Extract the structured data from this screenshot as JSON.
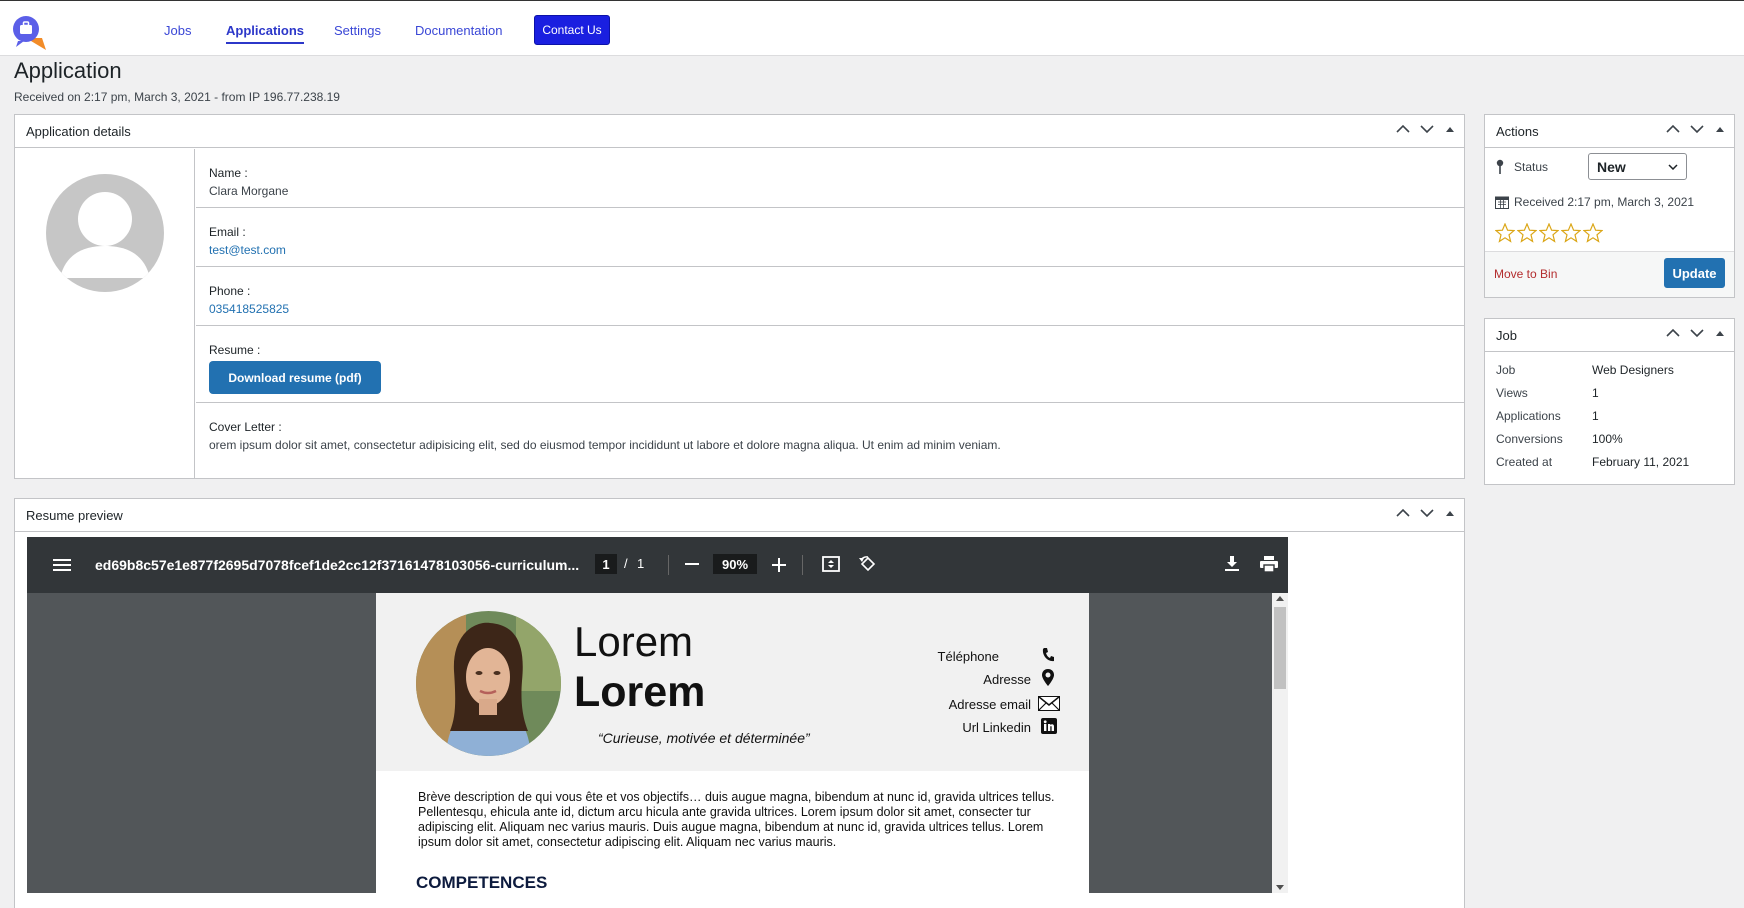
{
  "nav": {
    "items": [
      "Jobs",
      "Applications",
      "Settings",
      "Documentation"
    ],
    "contact_label": "Contact Us"
  },
  "page": {
    "title": "Application",
    "subtitle": "Received on 2:17 pm, March 3, 2021 - from IP 196.77.238.19"
  },
  "details": {
    "title": "Application details",
    "name_label": "Name :",
    "name_value": "Clara Morgane",
    "email_label": "Email :",
    "email_value": "test@test.com",
    "phone_label": "Phone :",
    "phone_value": "035418525825",
    "resume_label": "Resume :",
    "download_label": "Download resume (pdf)",
    "cover_label": "Cover Letter :",
    "cover_value": "orem ipsum dolor sit amet, consectetur adipisicing elit, sed do eiusmod tempor incididunt ut labore et dolore magna aliqua. Ut enim ad minim veniam."
  },
  "preview": {
    "title": "Resume preview",
    "filename": "ed69b8c57e1e877f2695d7078fcef1de2cc12f37161478103056-curriculum...",
    "page_current": "1",
    "page_sep": "/",
    "page_total": "1",
    "zoom": "90%",
    "cv": {
      "first_name": "Lorem",
      "last_name": "Lorem",
      "tagline": "“Curieuse, motivée et déterminée”",
      "contacts": [
        "Téléphone",
        "Adresse",
        "Adresse email",
        "Url Linkedin"
      ],
      "description": "Brève description de qui vous ête et vos objectifs… duis augue magna, bibendum at nunc id, gravida ultrices tellus. Pellentesqu, ehicula ante id, dictum arcu hicula ante gravida ultrices. Lorem ipsum dolor sit amet, consecter tur adipiscing elit. Aliquam nec varius mauris. Duis augue magna, bibendum at nunc id, gravida ultrices tellus. Lorem ipsum dolor sit amet, consectetur adipiscing elit. Aliquam nec varius mauris.",
      "section": "COMPETENCES"
    }
  },
  "actions": {
    "title": "Actions",
    "status_label": "Status",
    "status_value": "New",
    "received": "Received 2:17 pm, March 3, 2021",
    "rating": 0,
    "rating_max": 5,
    "bin_label": "Move to Bin",
    "update_label": "Update"
  },
  "job": {
    "title": "Job",
    "rows": [
      {
        "label": "Job",
        "value": "Web Designers"
      },
      {
        "label": "Views",
        "value": "1"
      },
      {
        "label": "Applications",
        "value": "1"
      },
      {
        "label": "Conversions",
        "value": "100%"
      },
      {
        "label": "Created at",
        "value": "February 11, 2021"
      }
    ]
  },
  "colors": {
    "nav_link": "#3a47d6",
    "contact_button": "#1a1fe0",
    "primary_button": "#2271b1",
    "bin_link": "#b32d2e",
    "star": "#dba617"
  }
}
